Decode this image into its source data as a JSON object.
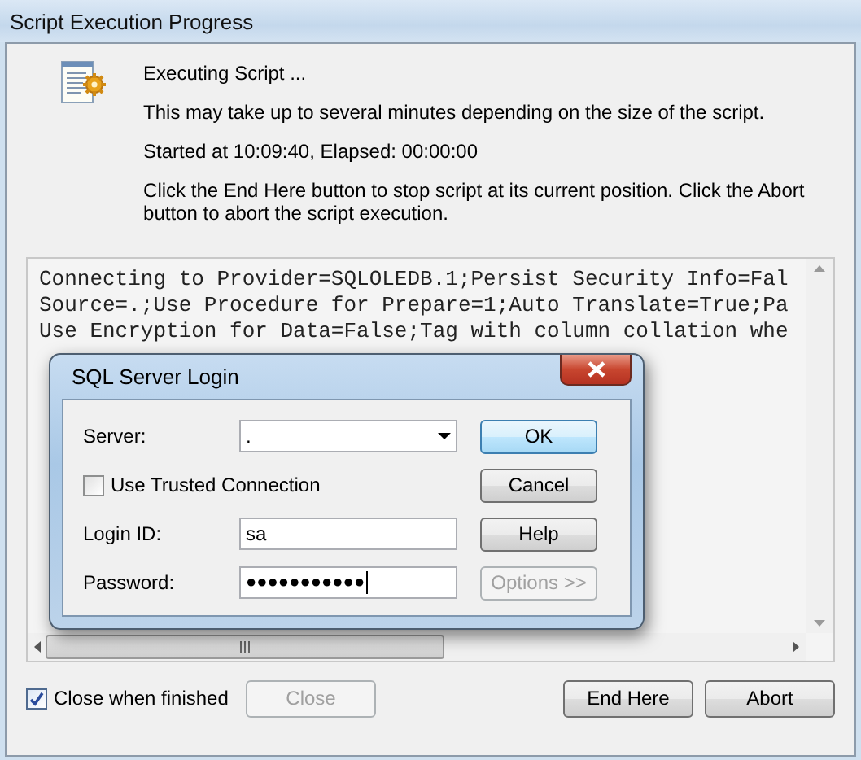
{
  "window": {
    "title": "Script Execution Progress"
  },
  "status": {
    "heading": "Executing Script ...",
    "lines": [
      "This may take up to several minutes depending on the size of the script.",
      "Started at 10:09:40, Elapsed: 00:00:00",
      "Click the End Here button to stop script at its current position. Click the Abort button to abort the script execution."
    ]
  },
  "log": {
    "lines": [
      "Connecting to Provider=SQLOLEDB.1;Persist Security Info=Fal",
      "Source=.;Use Procedure for Prepare=1;Auto Translate=True;Pa",
      "Use Encryption for Data=False;Tag with column collation whe"
    ]
  },
  "login_dialog": {
    "title": "SQL Server Login",
    "server": {
      "label": "Server:",
      "value": "."
    },
    "trusted_connection": {
      "label": "Use Trusted Connection",
      "checked": false
    },
    "login_id": {
      "label": "Login ID:",
      "value": "sa"
    },
    "password": {
      "label": "Password:",
      "value": "●●●●●●●●●●●"
    },
    "buttons": [
      {
        "label": "OK",
        "kind": "default",
        "disabled": false
      },
      {
        "label": "Cancel",
        "kind": "normal",
        "disabled": false
      },
      {
        "label": "Help",
        "kind": "normal",
        "disabled": false
      },
      {
        "label": "Options >>",
        "kind": "normal",
        "disabled": true
      }
    ]
  },
  "close_when_finished": {
    "label": "Close when finished",
    "checked": true
  },
  "buttons": [
    {
      "label": "Close",
      "disabled": true
    },
    {
      "label": "End Here",
      "disabled": false
    },
    {
      "label": "Abort",
      "disabled": false
    }
  ]
}
